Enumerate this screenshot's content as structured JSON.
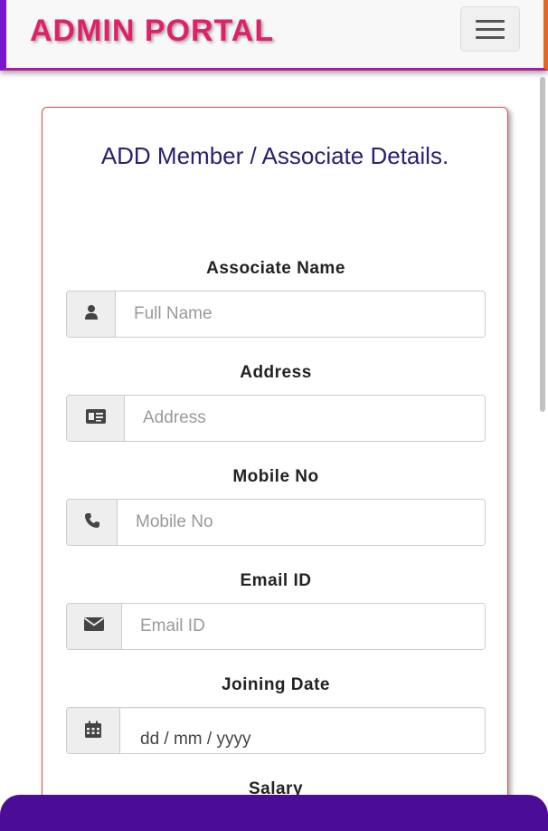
{
  "navbar": {
    "brand": "ADMIN PORTAL",
    "menu_icon": "hamburger-menu-icon"
  },
  "form": {
    "title": "ADD Member / Associate Details.",
    "fields": [
      {
        "label": "Associate Name",
        "placeholder": "Full Name",
        "icon": "user-icon"
      },
      {
        "label": "Address",
        "placeholder": "Address",
        "icon": "address-card-icon"
      },
      {
        "label": "Mobile No",
        "placeholder": "Mobile No",
        "icon": "phone-icon"
      },
      {
        "label": "Email ID",
        "placeholder": "Email ID",
        "icon": "envelope-icon"
      },
      {
        "label": "Joining Date",
        "value": "dd / mm / yyyy",
        "icon": "calendar-icon"
      },
      {
        "label": "Salary"
      }
    ]
  },
  "colors": {
    "brand": "#e0216a",
    "navbar_left_border": "#7a16c9",
    "navbar_right_border": "#e8661c",
    "card_border": "#e04848",
    "title": "#2a2170",
    "footer": "#4b0d96"
  }
}
